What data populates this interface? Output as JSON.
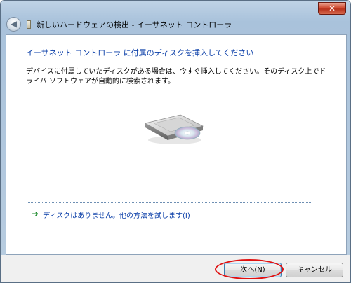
{
  "window": {
    "title": "新しいハードウェアの検出 - イーサネット コントローラ",
    "close_label": "✕",
    "back_icon": "back-arrow-icon"
  },
  "main": {
    "heading": "イーサネット コントローラ に付属のディスクを挿入してください",
    "description": "デバイスに付属していたディスクがある場合は、今すぐ挿入してください。そのディスク上でドライバ ソフトウェアが自動的に検索されます。",
    "illustration": "disk-drive-icon"
  },
  "option": {
    "arrow_icon": "green-arrow-icon",
    "label": "ディスクはありません。他の方法を試します(I)"
  },
  "footer": {
    "next_label": "次へ(N)",
    "cancel_label": "キャンセル"
  },
  "colors": {
    "accent_blue": "#0a3ea8",
    "highlight_red": "#e01010",
    "arrow_green": "#1d8a2c"
  }
}
